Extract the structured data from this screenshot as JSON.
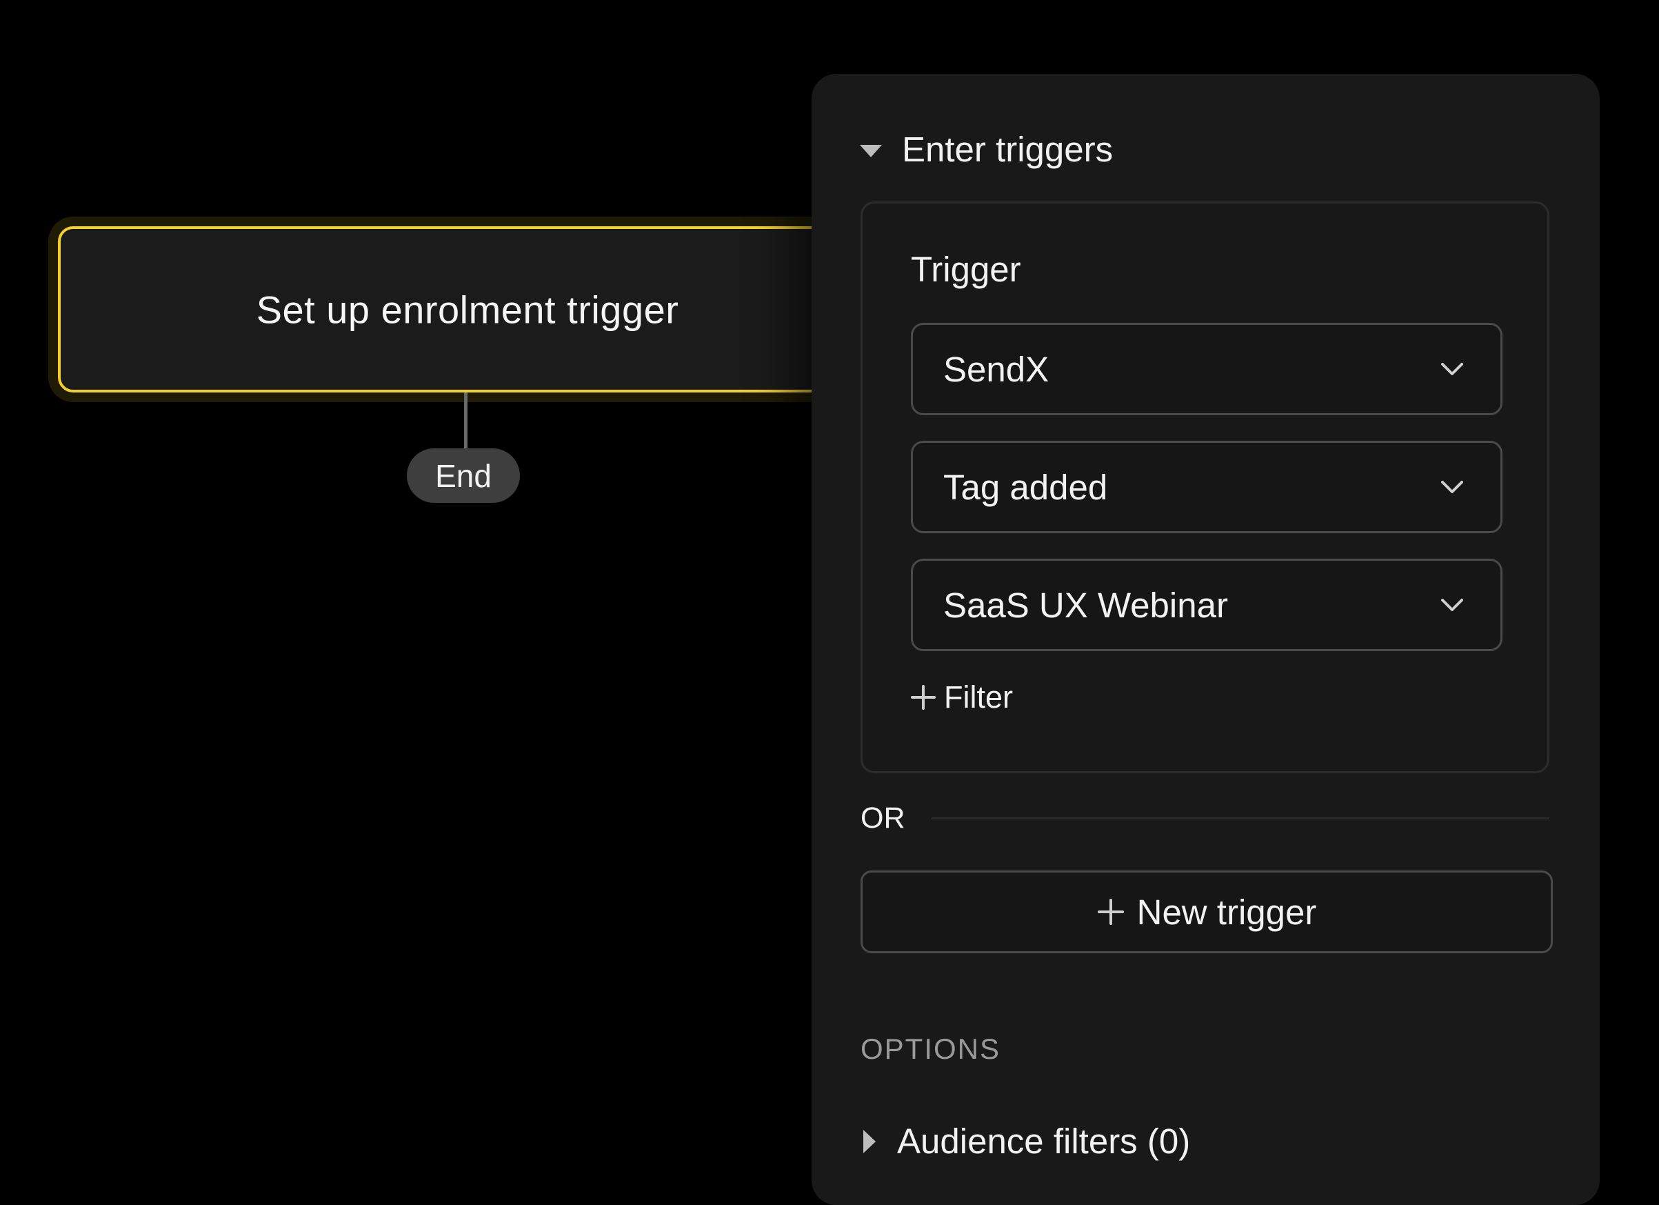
{
  "canvas": {
    "trigger_node": {
      "label": "Set up enrolment trigger",
      "accent_color": "#f3d027"
    },
    "end_node": {
      "label": "End"
    }
  },
  "panel": {
    "section": {
      "title": "Enter triggers",
      "icon": "caret-down-icon"
    },
    "trigger_card": {
      "label": "Trigger",
      "dropdowns": [
        {
          "value": "SendX",
          "icon": "chevron-down-icon"
        },
        {
          "value": "Tag added",
          "icon": "chevron-down-icon"
        },
        {
          "value": "SaaS UX Webinar",
          "icon": "chevron-down-icon"
        }
      ],
      "add_filter_label": "Filter",
      "add_filter_icon": "plus-icon"
    },
    "or_label": "OR",
    "new_trigger_label": "New trigger",
    "new_trigger_icon": "plus-icon",
    "options_heading": "OPTIONS",
    "audience_filters": {
      "label": "Audience filters (0)",
      "icon": "caret-right-icon"
    }
  }
}
